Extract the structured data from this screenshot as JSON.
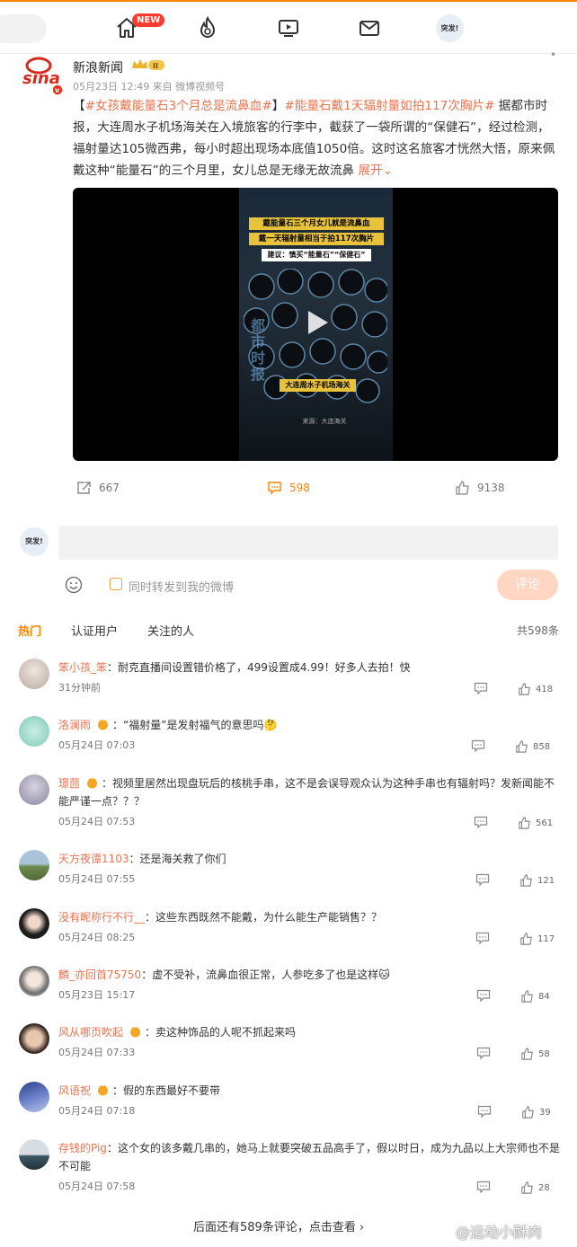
{
  "nav": {
    "new_badge": "NEW",
    "accent": "#ff8200"
  },
  "post": {
    "author": "新浪新闻",
    "meta": "05月23日 12:49   来自 微博视频号",
    "text_open": "【",
    "tag1": "#女孩戴能量石3个月总是流鼻血#",
    "text_mid1": "】",
    "tag2": "#能量石戴1天辐射量如拍117次胸片#",
    "text_body": " 据都市时报，大连周水子机场海关在入境旅客的行李中，截获了一袋所谓的“保健石”，经过检测，福射量达105微西弗，每小时超出现场本底值1050倍。这时这名旅客才恍然大悟，原来佩戴这种“能量石”的三个月里，女儿总是无缘无故流鼻",
    "expand": "展开",
    "video": {
      "caption1": "戴能量石三个月女儿就是流鼻血",
      "caption2": "戴一天辐射量相当于拍117次胸片",
      "caption3": "建议：慎买“能量石”“保健石”",
      "caption4": "大连周水子机场海关",
      "watermark": "都市时报",
      "credit": "来源：大连海关"
    },
    "reposts": "667",
    "comments": "598",
    "likes": "9138",
    "accent_link": "#eb7350"
  },
  "composer": {
    "me_avatar_text": "突发!",
    "input_placeholder": "",
    "repost_label": "同时转发到我的微博",
    "submit_label": "评论"
  },
  "filters": {
    "hot": "热门",
    "verified": "认证用户",
    "following": "关注的人",
    "total": "共598条"
  },
  "comments": [
    {
      "user": "笨小孩_笨",
      "text": "：耐克直播间设置错价格了，499设置成4.99！好多人去拍！快",
      "time": "31分钟前",
      "likes": "418"
    },
    {
      "user": "洛澜雨",
      "text": "：“福射量”是发射福气的意思吗🤔",
      "time": "05月24日 07:03",
      "likes": "858"
    },
    {
      "user": "璟茴",
      "text": "：视频里居然出现盘玩后的核桃手串，这不是会误导观众认为这种手串也有辐射吗？发新闻能不能严谨一点？？？",
      "time": "05月24日 07:53",
      "likes": "561"
    },
    {
      "user": "天方夜谭1103",
      "text": "：还是海关救了你们",
      "time": "05月24日 07:55",
      "likes": "121"
    },
    {
      "user": "没有昵称行不行__",
      "text": "：这些东西既然不能戴，为什么能生产能销售？？",
      "time": "05月24日 08:25",
      "likes": "117"
    },
    {
      "user": "麟_亦回首75750",
      "text": "：虚不受补，流鼻血很正常，人参吃多了也是这样🐱",
      "time": "05月23日 15:17",
      "likes": "84"
    },
    {
      "user": "风从哪页吹起",
      "text": "：卖这种饰品的人呢不抓起来吗",
      "time": "05月24日 07:33",
      "likes": "58"
    },
    {
      "user": "风语祝",
      "text": "：假的东西最好不要带",
      "time": "05月24日 07:18",
      "likes": "39"
    },
    {
      "user": "存钱的Pig",
      "text": "：这个女的该多戴几串的，她马上就要突破五品高手了，假以时日，成为九品以上大宗师也不是不可能",
      "time": "05月24日 07:58",
      "likes": "28"
    }
  ],
  "footer": {
    "more": "后面还有589条评论，点击查看",
    "watermark": "@运动小酥肉"
  }
}
